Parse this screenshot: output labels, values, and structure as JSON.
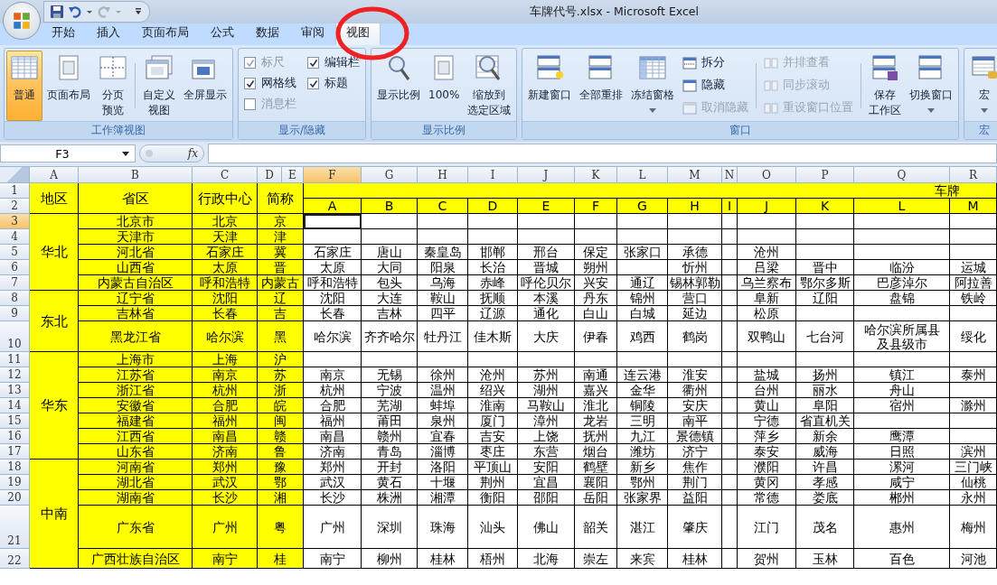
{
  "window": {
    "title": "车牌代号.xlsx - Microsoft Excel"
  },
  "tabs": [
    {
      "label": "开始",
      "selected": false
    },
    {
      "label": "插入",
      "selected": false
    },
    {
      "label": "页面布局",
      "selected": false
    },
    {
      "label": "公式",
      "selected": false
    },
    {
      "label": "数据",
      "selected": false
    },
    {
      "label": "审阅",
      "selected": false
    },
    {
      "label": "视图",
      "selected": true
    }
  ],
  "ribbon": {
    "groups": [
      {
        "label": "工作簿视图",
        "items": [
          {
            "kind": "large",
            "lines": [
              "普通"
            ],
            "selected": true
          },
          {
            "kind": "large",
            "lines": [
              "页面布局"
            ],
            "selected": false
          },
          {
            "kind": "large",
            "lines": [
              "分页",
              "预览"
            ],
            "selected": false
          },
          {
            "kind": "separator"
          },
          {
            "kind": "large",
            "lines": [
              "自定义",
              "视图"
            ]
          },
          {
            "kind": "large",
            "lines": [
              "全屏显示"
            ]
          }
        ]
      },
      {
        "label": "显示/隐藏",
        "items": [
          {
            "kind": "checkbox",
            "label": "标尺",
            "checked": true,
            "disabled": true
          },
          {
            "kind": "checkbox",
            "label": "网格线",
            "checked": true,
            "disabled": false
          },
          {
            "kind": "checkbox",
            "label": "消息栏",
            "checked": false,
            "disabled": true
          },
          {
            "kind": "checkbox",
            "label": "编辑栏",
            "checked": true,
            "disabled": false
          },
          {
            "kind": "checkbox",
            "label": "标题",
            "checked": true,
            "disabled": false
          }
        ]
      },
      {
        "label": "显示比例",
        "items": [
          {
            "kind": "large",
            "lines": [
              "显示比例"
            ]
          },
          {
            "kind": "large",
            "lines": [
              "100%"
            ]
          },
          {
            "kind": "large",
            "lines": [
              "缩放到",
              "选定区域"
            ]
          }
        ]
      },
      {
        "label": "窗口",
        "items": [
          {
            "kind": "large",
            "lines": [
              "新建窗口"
            ]
          },
          {
            "kind": "large",
            "lines": [
              "全部重排"
            ]
          },
          {
            "kind": "large",
            "lines": [
              "冻结窗格"
            ],
            "dropdown": true
          },
          {
            "kind": "stack",
            "items": [
              {
                "label": "拆分",
                "disabled": false
              },
              {
                "label": "隐藏",
                "disabled": false
              },
              {
                "label": "取消隐藏",
                "disabled": true
              }
            ]
          },
          {
            "kind": "separator"
          },
          {
            "kind": "stack",
            "items": [
              {
                "label": "并排查看",
                "disabled": true
              },
              {
                "label": "同步滚动",
                "disabled": true
              },
              {
                "label": "重设窗口位置",
                "disabled": true
              }
            ]
          },
          {
            "kind": "separator"
          },
          {
            "kind": "large",
            "lines": [
              "保存",
              "工作区"
            ]
          },
          {
            "kind": "large",
            "lines": [
              "切换窗口"
            ],
            "dropdown": true
          }
        ]
      },
      {
        "label": "宏",
        "items": [
          {
            "kind": "large",
            "lines": [
              "宏"
            ],
            "dropdown": true
          }
        ]
      }
    ]
  },
  "formula_bar": {
    "name_box": "F3",
    "function_label": "fx"
  },
  "sheet": {
    "column_headers": [
      {
        "label": "A",
        "selected": false
      },
      {
        "label": "B",
        "selected": false
      },
      {
        "label": "C",
        "selected": false
      },
      {
        "label": "D",
        "selected": false
      },
      {
        "label": "E",
        "selected": false
      },
      {
        "label": "F",
        "selected": true
      },
      {
        "label": "G",
        "selected": false
      },
      {
        "label": "H",
        "selected": false
      },
      {
        "label": "I",
        "selected": false
      },
      {
        "label": "J",
        "selected": false
      },
      {
        "label": "K",
        "selected": false
      },
      {
        "label": "L",
        "selected": false
      },
      {
        "label": "M",
        "selected": false
      },
      {
        "label": "N",
        "selected": false
      },
      {
        "label": "O",
        "selected": false
      },
      {
        "label": "P",
        "selected": false
      },
      {
        "label": "Q",
        "selected": false
      },
      {
        "label": "R",
        "selected": false
      }
    ],
    "row_numbers": [
      {
        "label": "1",
        "selected": false
      },
      {
        "label": "2",
        "selected": false
      },
      {
        "label": "3",
        "selected": true
      },
      {
        "label": "4",
        "selected": false
      },
      {
        "label": "5",
        "selected": false
      },
      {
        "label": "6",
        "selected": false
      },
      {
        "label": "7",
        "selected": false
      },
      {
        "label": "8",
        "selected": false
      },
      {
        "label": "9",
        "selected": false
      },
      {
        "label": "10",
        "selected": false
      },
      {
        "label": "11",
        "selected": false
      },
      {
        "label": "12",
        "selected": false
      },
      {
        "label": "13",
        "selected": false
      },
      {
        "label": "14",
        "selected": false
      },
      {
        "label": "15",
        "selected": false
      },
      {
        "label": "16",
        "selected": false
      },
      {
        "label": "17",
        "selected": false
      },
      {
        "label": "18",
        "selected": false
      },
      {
        "label": "19",
        "selected": false
      },
      {
        "label": "20",
        "selected": false
      },
      {
        "label": "21",
        "selected": false
      },
      {
        "label": "22",
        "selected": false
      }
    ],
    "headers": [
      "地区",
      "省区",
      "行政中心",
      "简称"
    ],
    "plate_title": "车牌",
    "plate_columns": [
      "A",
      "B",
      "C",
      "D",
      "E",
      "F",
      "G",
      "H",
      "I",
      "J",
      "K",
      "L",
      "M"
    ],
    "regions": [
      {
        "name": "华北",
        "provinces": [
          {
            "province": "北京市",
            "capital": "北京",
            "abbr": "京"
          },
          {
            "province": "天津市",
            "capital": "天津",
            "abbr": "津"
          },
          {
            "province": "河北省",
            "capital": "石家庄",
            "abbr": "冀",
            "cities": {
              "A": "石家庄",
              "B": "唐山",
              "C": "秦皇岛",
              "D": "邯郸",
              "E": "邢台",
              "F": "保定",
              "G": "张家口",
              "H": "承德",
              "J": "沧州"
            }
          },
          {
            "province": "山西省",
            "capital": "太原",
            "abbr": "晋",
            "cities": {
              "A": "太原",
              "B": "大同",
              "C": "阳泉",
              "D": "长治",
              "E": "晋城",
              "F": "朔州",
              "H": "忻州",
              "J": "吕梁",
              "K": "晋中",
              "L": "临汾",
              "M": "运城"
            }
          },
          {
            "province": "内蒙古自治区",
            "capital": "呼和浩特",
            "abbr": "内蒙古",
            "cities": {
              "A": "呼和浩特",
              "B": "包头",
              "C": "乌海",
              "D": "赤峰",
              "E": "呼伦贝尔",
              "F": "兴安",
              "G": "通辽",
              "H": "锡林郭勒",
              "J": "乌兰察布",
              "K": "鄂尔多斯",
              "L": "巴彦淖尔",
              "M": "阿拉善"
            }
          }
        ]
      },
      {
        "name": "东北",
        "provinces": [
          {
            "province": "辽宁省",
            "capital": "沈阳",
            "abbr": "辽",
            "cities": {
              "A": "沈阳",
              "B": "大连",
              "C": "鞍山",
              "D": "抚顺",
              "E": "本溪",
              "F": "丹东",
              "G": "锦州",
              "H": "营口",
              "J": "阜新",
              "K": "辽阳",
              "L": "盘锦",
              "M": "铁岭"
            }
          },
          {
            "province": "吉林省",
            "capital": "长春",
            "abbr": "吉",
            "cities": {
              "A": "长春",
              "B": "吉林",
              "C": "四平",
              "D": "辽源",
              "E": "通化",
              "F": "白山",
              "G": "白城",
              "H": "延边",
              "J": "松原"
            }
          },
          {
            "province": "黑龙江省",
            "capital": "哈尔滨",
            "abbr": "黑",
            "cities": {
              "A": "哈尔滨",
              "B": "齐齐哈尔",
              "C": "牡丹江",
              "D": "佳木斯",
              "E": "大庆",
              "F": "伊春",
              "G": "鸡西",
              "H": "鹤岗",
              "J": "双鸭山",
              "K": "七台河",
              "L": "哈尔滨所属县及县级市",
              "M": "绥化"
            }
          }
        ]
      },
      {
        "name": "华东",
        "provinces": [
          {
            "province": "上海市",
            "capital": "上海",
            "abbr": "沪"
          },
          {
            "province": "江苏省",
            "capital": "南京",
            "abbr": "苏",
            "cities": {
              "A": "南京",
              "B": "无锡",
              "C": "徐州",
              "D": "沧州",
              "E": "苏州",
              "F": "南通",
              "G": "连云港",
              "H": "淮安",
              "J": "盐城",
              "K": "扬州",
              "L": "镇江",
              "M": "泰州"
            }
          },
          {
            "province": "浙江省",
            "capital": "杭州",
            "abbr": "浙",
            "cities": {
              "A": "杭州",
              "B": "宁波",
              "C": "温州",
              "D": "绍兴",
              "E": "湖州",
              "F": "嘉兴",
              "G": "金华",
              "H": "衢州",
              "J": "台州",
              "K": "丽水",
              "L": "舟山"
            }
          },
          {
            "province": "安徽省",
            "capital": "合肥",
            "abbr": "皖",
            "cities": {
              "A": "合肥",
              "B": "芜湖",
              "C": "蚌埠",
              "D": "淮南",
              "E": "马鞍山",
              "F": "淮北",
              "G": "铜陵",
              "H": "安庆",
              "J": "黄山",
              "K": "阜阳",
              "L": "宿州",
              "M": "滁州"
            }
          },
          {
            "province": "福建省",
            "capital": "福州",
            "abbr": "闽",
            "cities": {
              "A": "福州",
              "B": "莆田",
              "C": "泉州",
              "D": "厦门",
              "E": "漳州",
              "F": "龙岩",
              "G": "三明",
              "H": "南平",
              "J": "宁德",
              "K": "省直机关"
            }
          },
          {
            "province": "江西省",
            "capital": "南昌",
            "abbr": "赣",
            "cities": {
              "A": "南昌",
              "B": "赣州",
              "C": "宜春",
              "D": "吉安",
              "E": "上饶",
              "F": "抚州",
              "G": "九江",
              "H": "景德镇",
              "J": "萍乡",
              "K": "新余",
              "L": "鹰潭"
            }
          },
          {
            "province": "山东省",
            "capital": "济南",
            "abbr": "鲁",
            "cities": {
              "A": "济南",
              "B": "青岛",
              "C": "淄博",
              "D": "枣庄",
              "E": "东营",
              "F": "烟台",
              "G": "潍坊",
              "H": "济宁",
              "J": "泰安",
              "K": "威海",
              "L": "日照",
              "M": "滨州"
            }
          }
        ]
      },
      {
        "name": "中南",
        "provinces": [
          {
            "province": "河南省",
            "capital": "郑州",
            "abbr": "豫",
            "cities": {
              "A": "郑州",
              "B": "开封",
              "C": "洛阳",
              "D": "平顶山",
              "E": "安阳",
              "F": "鹤壁",
              "G": "新乡",
              "H": "焦作",
              "J": "濮阳",
              "K": "许昌",
              "L": "漯河",
              "M": "三门峡"
            }
          },
          {
            "province": "湖北省",
            "capital": "武汉",
            "abbr": "鄂",
            "cities": {
              "A": "武汉",
              "B": "黄石",
              "C": "十堰",
              "D": "荆州",
              "E": "宜昌",
              "F": "襄阳",
              "G": "鄂州",
              "H": "荆门",
              "J": "黄冈",
              "K": "孝感",
              "L": "咸宁",
              "M": "仙桃"
            }
          },
          {
            "province": "湖南省",
            "capital": "长沙",
            "abbr": "湘",
            "cities": {
              "A": "长沙",
              "B": "株洲",
              "C": "湘潭",
              "D": "衡阳",
              "E": "邵阳",
              "F": "岳阳",
              "G": "张家界",
              "H": "益阳",
              "J": "常德",
              "K": "娄底",
              "L": "郴州",
              "M": "永州"
            }
          },
          {
            "province": "广东省",
            "capital": "广州",
            "abbr": "粤",
            "cities": {
              "A": "广州",
              "B": "深圳",
              "C": "珠海",
              "D": "汕头",
              "E": "佛山",
              "F": "韶关",
              "G": "湛江",
              "H": "肇庆",
              "J": "江门",
              "K": "茂名",
              "L": "惠州",
              "M": "梅州"
            }
          },
          {
            "province": "广西壮族自治区",
            "capital": "南宁",
            "abbr": "桂",
            "cities": {
              "A": "南宁",
              "B": "柳州",
              "C": "桂林",
              "D": "梧州",
              "E": "北海",
              "F": "崇左",
              "G": "来宾",
              "H": "桂林",
              "J": "贺州",
              "K": "玉林",
              "L": "百色",
              "M": "河池"
            }
          }
        ]
      }
    ]
  }
}
